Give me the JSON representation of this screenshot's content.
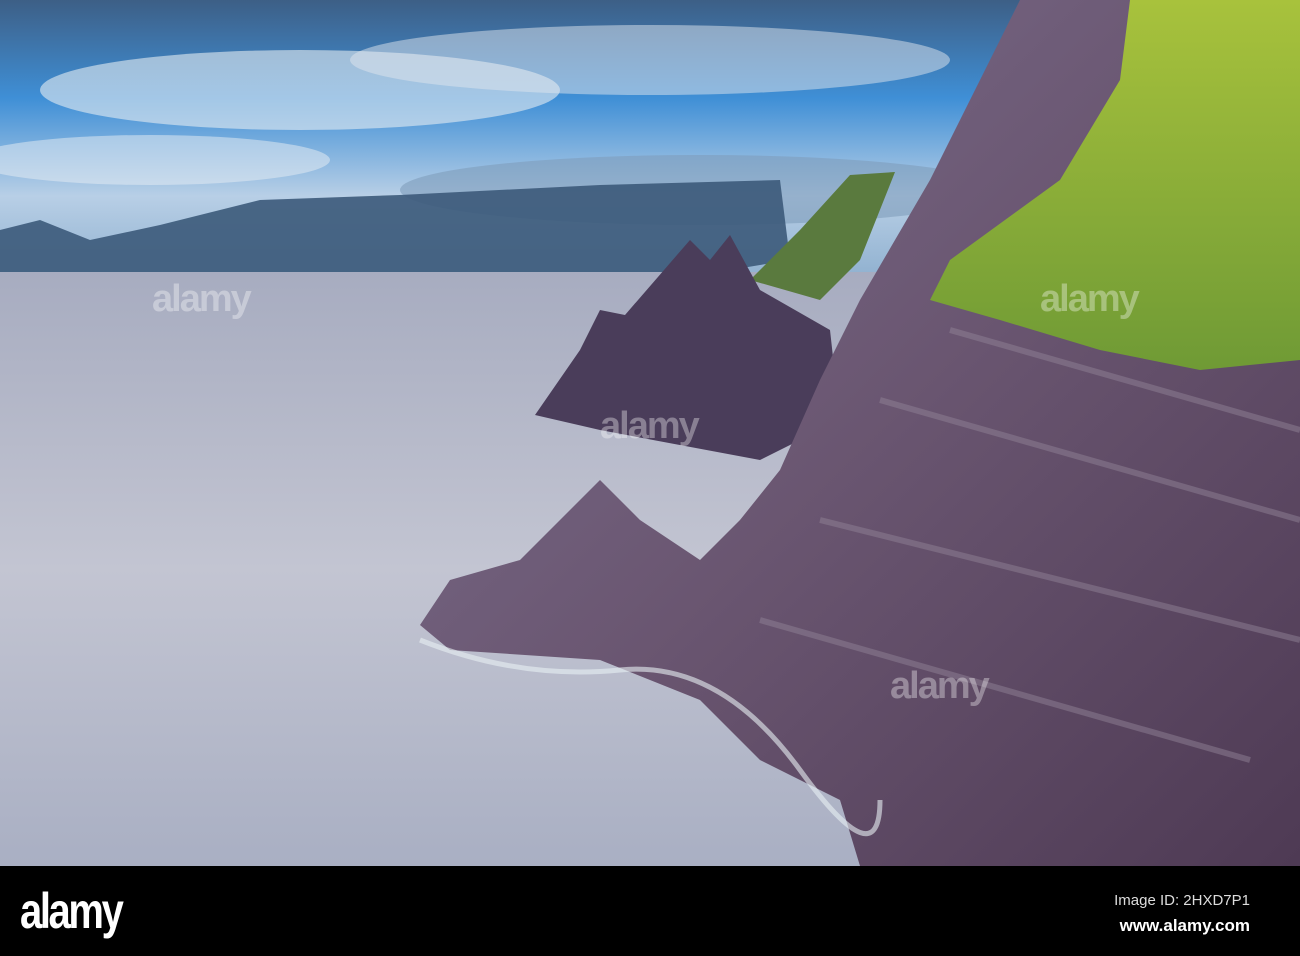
{
  "watermark": {
    "logo": "alamy",
    "image_id": "Image ID: 2HXD7P1",
    "url": "www.alamy.com"
  },
  "colors": {
    "sky": "#3f8fd6",
    "sea": "#b9bccb",
    "cliff": "#5f4a66",
    "grass": "#9cbb3a",
    "bar": "#000000"
  }
}
